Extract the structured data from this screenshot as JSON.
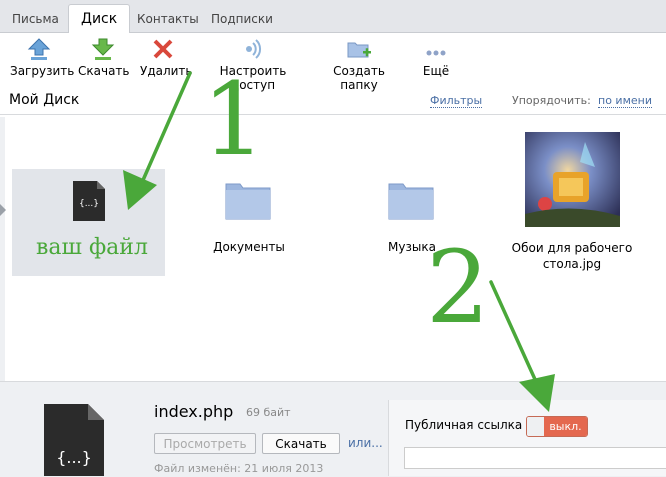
{
  "tabs": [
    {
      "label": "Письма"
    },
    {
      "label": "Диск"
    },
    {
      "label": "Контакты"
    },
    {
      "label": "Подписки"
    }
  ],
  "toolbar": {
    "upload": "Загрузить",
    "download": "Скачать",
    "delete": "Удалить",
    "share": "Настроить доступ",
    "new_folder": "Создать папку",
    "more": "Ещё"
  },
  "header": {
    "title": "Мой Диск",
    "filters": "Фильтры",
    "sort_label": "Упорядочить:",
    "sort_value": "по имени"
  },
  "files": [
    {
      "name": "Документы",
      "icon": "folder-icon"
    },
    {
      "name": "Музыка",
      "icon": "folder-icon"
    },
    {
      "name": "Обои для рабочего стола.jpg",
      "icon": "image-thumbnail"
    }
  ],
  "file_icon_glyph": "{...}",
  "details": {
    "name": "index.php",
    "size": "69 байт",
    "view_btn": "Просмотреть",
    "download_btn": "Скачать",
    "or": "или...",
    "modified": "Файл изменён: 21 июля 2013",
    "public_link_label": "Публичная ссылка",
    "toggle_state": "выкл."
  },
  "annotations": {
    "step1": "1",
    "step2": "2",
    "your_file": "ваш файл"
  },
  "colors": {
    "annotation_green": "#4aa83a",
    "toggle_red": "#e4684f",
    "link_blue": "#4a6fa5"
  }
}
